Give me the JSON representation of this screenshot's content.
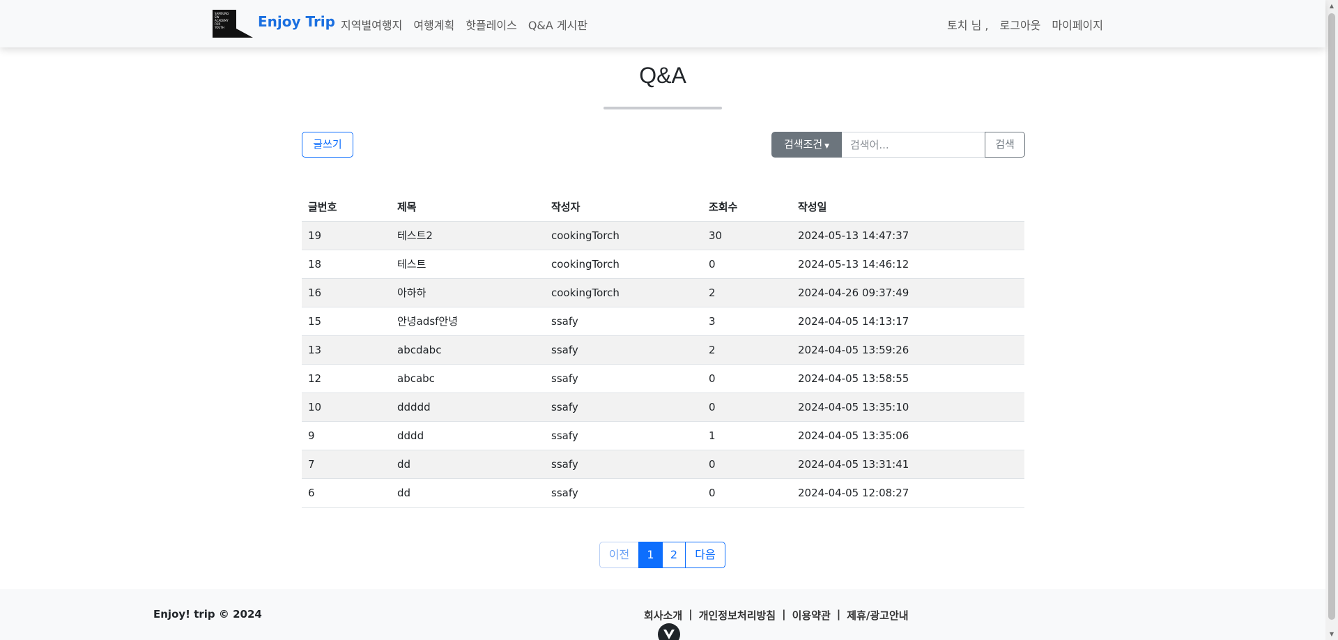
{
  "nav": {
    "brand": "Enjoy Trip",
    "logo_text": "SAMSUNG SW ACADEMY FOR YOUTH",
    "links": [
      "지역별여행지",
      "여행계획",
      "핫플레이스",
      "Q&A 게시판"
    ],
    "user_greeting": "토치 님 ,",
    "logout": "로그아웃",
    "mypage": "마이페이지"
  },
  "page": {
    "title": "Q&A"
  },
  "toolbar": {
    "write_label": "글쓰기",
    "search_condition_label": "검색조건",
    "search_placeholder": "검색어...",
    "search_button": "검색"
  },
  "table": {
    "headers": [
      "글번호",
      "제목",
      "작성자",
      "조회수",
      "작성일"
    ],
    "rows": [
      [
        "19",
        "테스트2",
        "cookingTorch",
        "30",
        "2024-05-13 14:47:37"
      ],
      [
        "18",
        "테스트",
        "cookingTorch",
        "0",
        "2024-05-13 14:46:12"
      ],
      [
        "16",
        "아하하",
        "cookingTorch",
        "2",
        "2024-04-26 09:37:49"
      ],
      [
        "15",
        "안녕adsf안녕",
        "ssafy",
        "3",
        "2024-04-05 14:13:17"
      ],
      [
        "13",
        "abcdabc",
        "ssafy",
        "2",
        "2024-04-05 13:59:26"
      ],
      [
        "12",
        "abcabc",
        "ssafy",
        "0",
        "2024-04-05 13:58:55"
      ],
      [
        "10",
        "ddddd",
        "ssafy",
        "0",
        "2024-04-05 13:35:10"
      ],
      [
        "9",
        "dddd",
        "ssafy",
        "1",
        "2024-04-05 13:35:06"
      ],
      [
        "7",
        "dd",
        "ssafy",
        "0",
        "2024-04-05 13:31:41"
      ],
      [
        "6",
        "dd",
        "ssafy",
        "0",
        "2024-04-05 12:08:27"
      ]
    ]
  },
  "pagination": {
    "prev": "이전",
    "pages": [
      "1",
      "2"
    ],
    "current": "1",
    "next": "다음"
  },
  "footer": {
    "copyright": "Enjoy! trip © 2024",
    "links": [
      "회사소개",
      "개인정보처리방침",
      "이용약관",
      "제휴/광고안내"
    ],
    "separator": "|"
  },
  "colors": {
    "accent": "#0d6efd",
    "brand": "#1a6fe0",
    "secondary": "#6c757d"
  }
}
